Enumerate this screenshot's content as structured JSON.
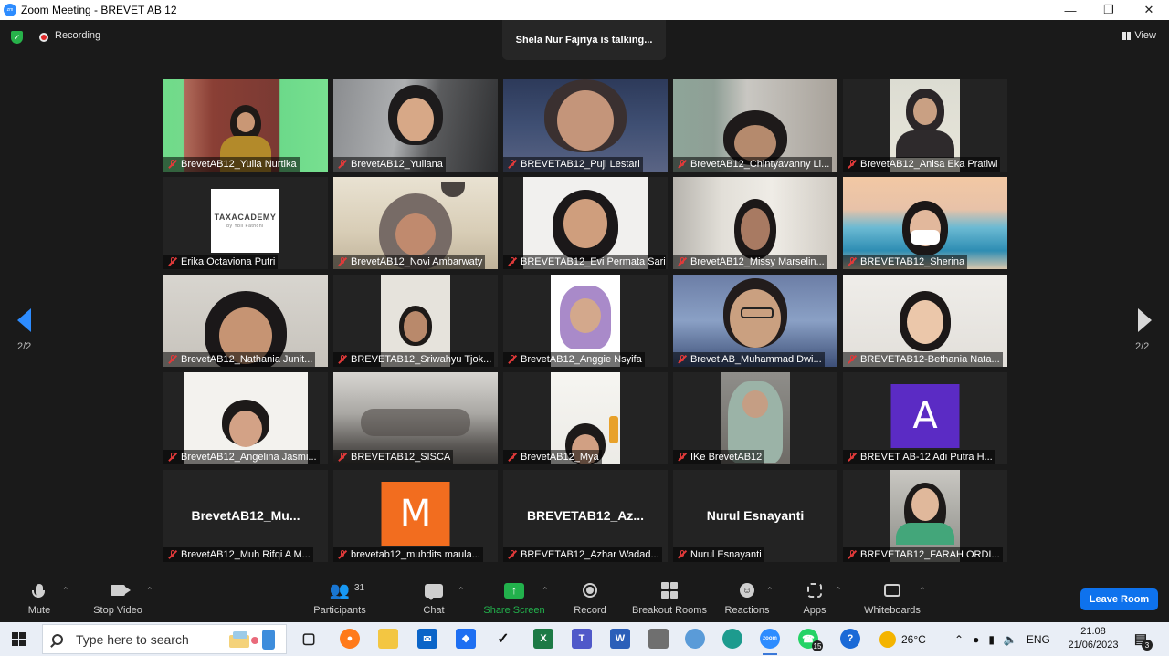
{
  "window": {
    "app_icon": "zoom",
    "title": "Zoom Meeting - BREVET AB 12"
  },
  "topbar": {
    "recording_label": "Recording",
    "talking_text": "Shela Nur Fajriya is talking...",
    "view_label": "View"
  },
  "participants": [
    {
      "name": "BrevetAB12_Yulia Nurtika"
    },
    {
      "name": "BrevetAB12_Yuliana"
    },
    {
      "name": "BREVETAB12_Puji Lestari"
    },
    {
      "name": "BrevetAB12_Chintyavanny Li..."
    },
    {
      "name": "BrevetAB12_Anisa Eka Pratiwi"
    },
    {
      "name": "Erika Octaviona Putri",
      "avatar_text": "TAXACADEMY",
      "avatar_subtext": "by Ybil Fathoni"
    },
    {
      "name": "BrevetAB12_Novi Ambarwaty"
    },
    {
      "name": "BREVETAB12_Evi Permata Sari"
    },
    {
      "name": "BrevetAB12_Missy Marselin..."
    },
    {
      "name": "BREVETAB12_Sherina"
    },
    {
      "name": "BrevetAB12_Nathania Junit..."
    },
    {
      "name": "BREVETAB12_Sriwahyu Tjok..."
    },
    {
      "name": "BrevetAB12_Anggie Nsyifa"
    },
    {
      "name": "Brevet AB_Muhammad Dwi..."
    },
    {
      "name": "BREVETAB12-Bethania Nata..."
    },
    {
      "name": "BrevetAB12_Angelina Jasmi..."
    },
    {
      "name": "BREVETAB12_SISCA"
    },
    {
      "name": "BrevetAB12_Mya"
    },
    {
      "name": "IKe BrevetAB12"
    },
    {
      "name": "BREVET AB-12 Adi Putra H...",
      "avatar_letter": "A"
    },
    {
      "name": "BrevetAB12_Muh Rifqi A M...",
      "big_name": "BrevetAB12_Mu..."
    },
    {
      "name": "brevetab12_muhdits maula...",
      "avatar_letter": "M"
    },
    {
      "name": "BREVETAB12_Azhar Wadad...",
      "big_name": "BREVETAB12_Az..."
    },
    {
      "name": "Nurul Esnayanti",
      "big_name": "Nurul Esnayanti"
    },
    {
      "name": "BREVETAB12_FARAH ORDI..."
    }
  ],
  "pagination": {
    "left": "2/2",
    "right": "2/2"
  },
  "controls": {
    "mute": "Mute",
    "stop_video": "Stop Video",
    "participants": "Participants",
    "participants_count": "31",
    "chat": "Chat",
    "share_screen": "Share Screen",
    "record": "Record",
    "breakout_rooms": "Breakout Rooms",
    "reactions": "Reactions",
    "apps": "Apps",
    "whiteboards": "Whiteboards",
    "leave": "Leave Room"
  },
  "taskbar": {
    "search_placeholder": "Type here to search",
    "whatsapp_badge": "15",
    "weather": "26°C",
    "language": "ENG",
    "time": "21.08",
    "date": "21/06/2023",
    "notification_count": "3"
  },
  "colors": {
    "accent": "#2d8cff",
    "share_green": "#22b14c",
    "leave_blue": "#0e72ed",
    "muted_red": "#e03a3a",
    "avatar_purple": "#5b2bc4",
    "avatar_orange": "#f26d1f"
  }
}
